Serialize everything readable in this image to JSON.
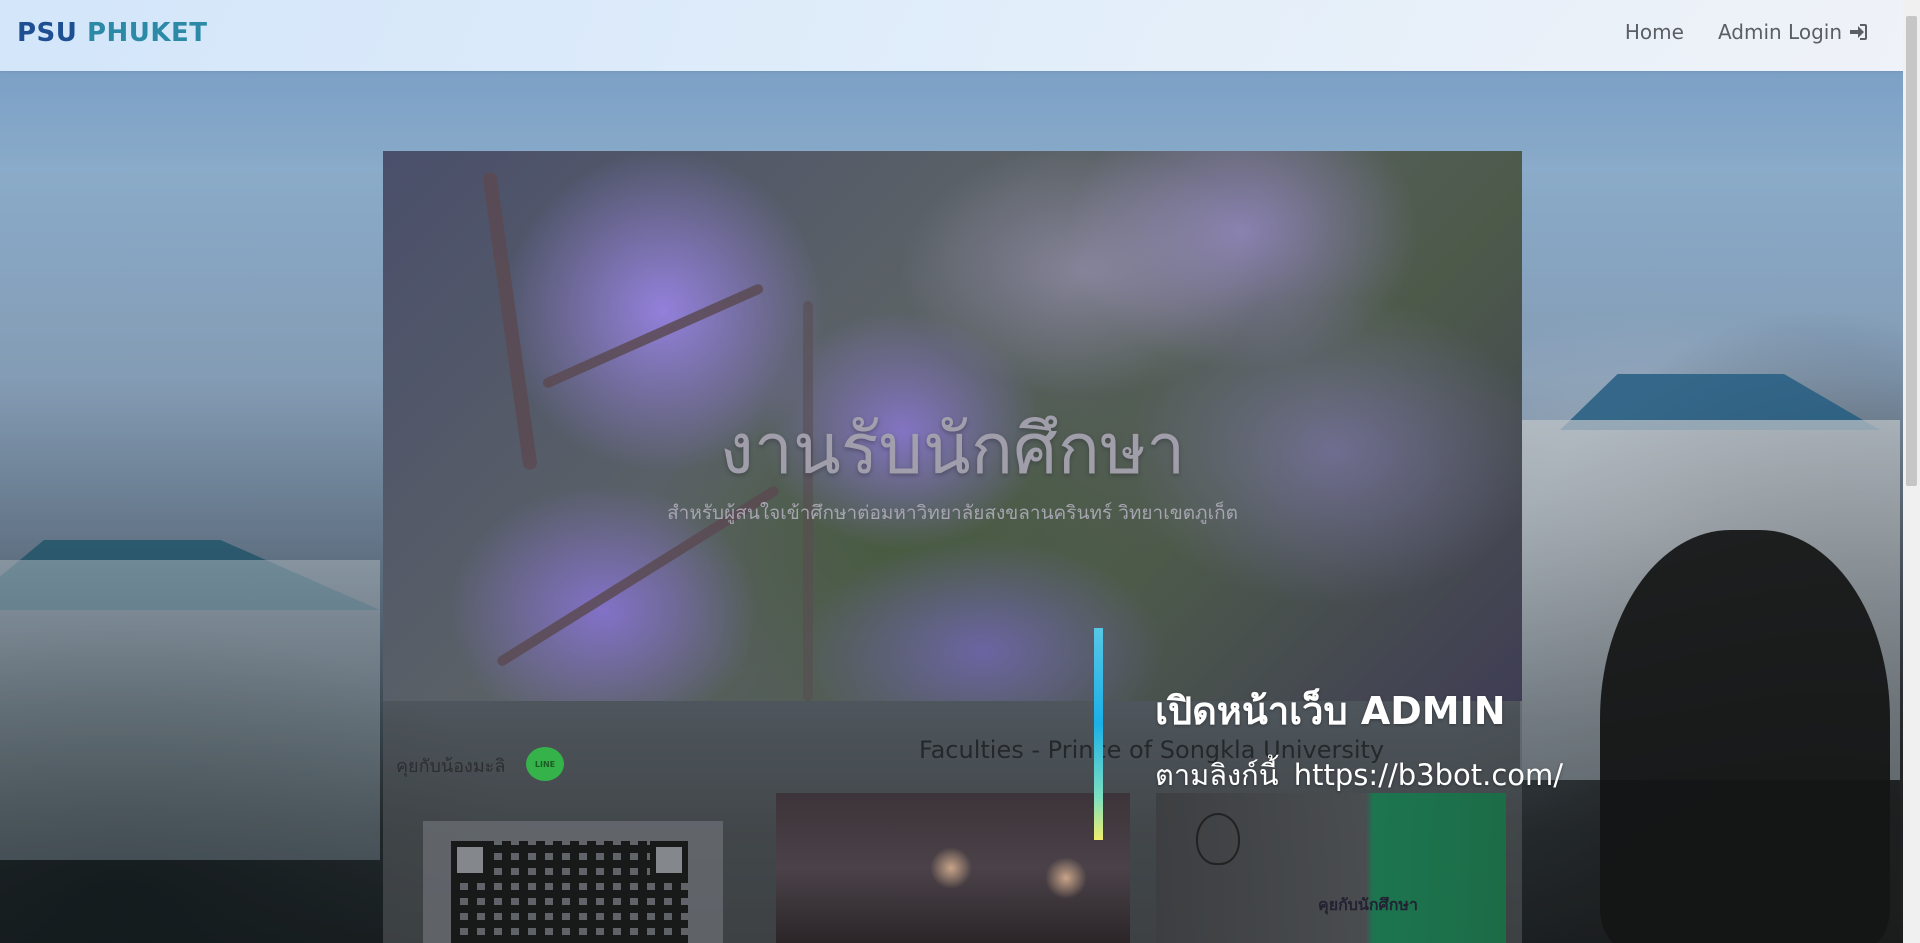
{
  "navbar": {
    "brand_part1": "PSU",
    "brand_part2": "PHUKET",
    "links": [
      {
        "label": "Home"
      },
      {
        "label": "Admin Login",
        "icon": "sign-in-icon"
      }
    ]
  },
  "hero": {
    "title": "งานรับนักศึกษา",
    "subtitle": "สำหรับผู้สนใจเข้าศึกษาต่อมหาวิทยาลัยสงขลานครินทร์ วิทยาเขตภูเก็ต"
  },
  "sidebar": {
    "chat_label": "คุยกับน้องมะลิ",
    "chat_icon": "line-icon",
    "chat_icon_text": "LINE"
  },
  "faculties": {
    "title": "Faculties - Prince of Songkla University"
  },
  "partial_label": "คุยกับนักศึกษา",
  "overlay": {
    "title": "เปิดหน้าเว็บ ADMIN",
    "line_prefix": "ตามลิงก์นี้",
    "url": "https://b3bot.com/"
  },
  "colors": {
    "brand_dark": "#1d4f92",
    "brand_light": "#2d8aa6",
    "accent_gradient_top": "#57c7e6",
    "accent_gradient_bottom": "#f1ee6e"
  }
}
